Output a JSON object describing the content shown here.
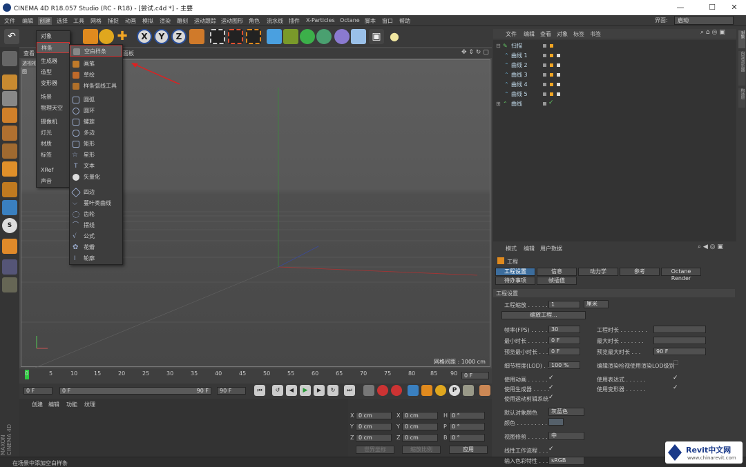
{
  "window": {
    "title": "CINEMA 4D R18.057 Studio (RC - R18) - [尝试.c4d *] - 主要",
    "min": "—",
    "max": "☐",
    "close": "✕"
  },
  "menubar": {
    "items": [
      "文件",
      "编辑",
      "创建",
      "选择",
      "工具",
      "网格",
      "捕捉",
      "动画",
      "模拟",
      "渲染",
      "雕刻",
      "运动跟踪",
      "运动图形",
      "角色",
      "流水线",
      "插件",
      "X-Particles",
      "Octane",
      "脚本",
      "窗口",
      "帮助"
    ],
    "interface_label": "界面:",
    "interface_value": "启动"
  },
  "viewport": {
    "menu": [
      "查看",
      "摄像机",
      "显示",
      "选项",
      "过滤",
      "面板"
    ],
    "view_label": "透视视图",
    "grid_info": "网格间距 : 1000 cm"
  },
  "create_menu": {
    "items": [
      "对象",
      "样条",
      "生成器",
      "造型",
      "变形器",
      "场景",
      "物理天空",
      "摄像机",
      "灯光",
      "材质",
      "标签",
      "XRef",
      "声音"
    ]
  },
  "spline_menu": {
    "items": [
      "空白样条",
      "画笔",
      "草绘",
      "样条弧线工具",
      "圆弧",
      "圆环",
      "螺旋",
      "多边",
      "矩形",
      "星形",
      "文本",
      "矢量化",
      "四边",
      "蔓叶类曲线",
      "齿轮",
      "摆线",
      "公式",
      "花瓣",
      "轮廓"
    ]
  },
  "timeline": {
    "ticks": [
      "0",
      "5",
      "10",
      "15",
      "20",
      "25",
      "30",
      "35",
      "40",
      "45",
      "50",
      "55",
      "60",
      "65",
      "70",
      "75",
      "80",
      "85",
      "90"
    ],
    "frame_end": "0 F",
    "field1": "0 F",
    "field2": "0 F",
    "field3": "90 F",
    "field4": "90 F"
  },
  "materials": {
    "menu": [
      "创建",
      "编辑",
      "功能",
      "纹理"
    ]
  },
  "coords": {
    "rows": [
      [
        "X",
        "0 cm",
        "X",
        "0 cm",
        "H",
        "0 °"
      ],
      [
        "Y",
        "0 cm",
        "Y",
        "0 cm",
        "P",
        "0 °"
      ],
      [
        "Z",
        "0 cm",
        "Z",
        "0 cm",
        "B",
        "0 °"
      ]
    ],
    "mode1": "世界坐标",
    "mode2": "缩放比例",
    "apply": "应用"
  },
  "status": {
    "text": "在场景中添加空白样条"
  },
  "object_manager": {
    "menu": [
      "文件",
      "编辑",
      "查看",
      "对象",
      "标签",
      "书签"
    ],
    "objects": [
      "扫描",
      "曲线 1",
      "曲线 2",
      "曲线 3",
      "曲线 4",
      "曲线 5",
      "曲线"
    ]
  },
  "attributes": {
    "menu": [
      "模式",
      "编辑",
      "用户数据"
    ],
    "title": "工程",
    "tabs": [
      "工程设置",
      "信息",
      "动力学",
      "参考",
      "Octane Render",
      "待办事项",
      "帧插值"
    ],
    "section": "工程设置",
    "scale_label": "工程缩放 . . . . . . . .",
    "scale_value": "1",
    "scale_unit": "厘米",
    "scale_button": "缩放工程...",
    "fps_label": "帧率(FPS) . . . . . .",
    "fps_value": "30",
    "project_length_label": "工程时长 . . . . . . . .",
    "project_length_value": "",
    "min_time_label": "最小时长 . . . . . . .",
    "min_time_value": "0 F",
    "max_time_label": "最大时长 . . . . . . .",
    "max_time_value": "",
    "preview_min_label": "预览最小时长 . . .",
    "preview_min_value": "0 F",
    "preview_max_label": "预览最大时长 . . .",
    "preview_max_value": "90 F",
    "lod_label": "细节程度(LOD) . . .",
    "lod_value": "100 %",
    "lod_render_label": "编辑渲染检视使用渲染LOD级别",
    "use_anim": "使用动画 . . . . . .",
    "use_expr": "使用表达式 . . . . . .",
    "use_gen": "使用生成器 . . . . .",
    "use_deform": "使用变形器 . . . . . .",
    "use_motion": "使用运动剪辑系统",
    "default_color_label": "默认对象颜色",
    "default_color_value": "灰蓝色",
    "color_label": "颜色 . . . . . . . . .",
    "clip_label": "视图修剪 . . . . . . .",
    "clip_value": "中",
    "linear_label": "线性工作流程 . . .",
    "input_color_label": "输入色彩特性 . . .",
    "input_color_value": "sRGB"
  },
  "side_tabs": [
    "对象",
    "内容浏览器",
    "构造",
    "层"
  ],
  "watermark": {
    "brand": "Revit中文网",
    "url": "www.chinarevit.com"
  }
}
